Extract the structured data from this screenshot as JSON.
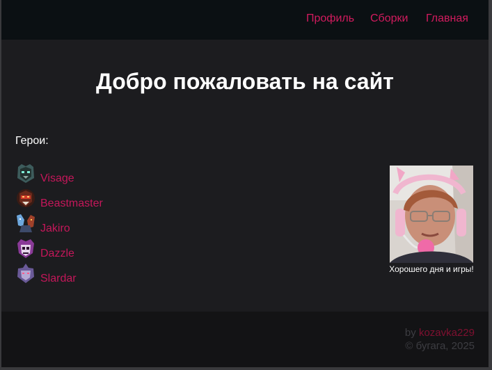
{
  "nav": {
    "links": [
      {
        "label": "Профиль"
      },
      {
        "label": "Сборки"
      },
      {
        "label": "Главная"
      }
    ]
  },
  "main": {
    "title": "Добро пожаловать на сайт",
    "heroes_label": "Герои:",
    "heroes": [
      {
        "name": "Visage",
        "icon": "visage-icon",
        "color": "#4a7a7a"
      },
      {
        "name": "Beastmaster",
        "icon": "beastmaster-icon",
        "color": "#b8382c"
      },
      {
        "name": "Jakiro",
        "icon": "jakiro-icon",
        "color": "#5a8fc8"
      },
      {
        "name": "Dazzle",
        "icon": "dazzle-icon",
        "color": "#9a4aa8"
      },
      {
        "name": "Slardar",
        "icon": "slardar-icon",
        "color": "#8a7ab8"
      }
    ],
    "promo_caption": "Хорошего дня и игры!"
  },
  "footer": {
    "by": "by",
    "author": "kozavka229",
    "copyright": "© бугага, 2025"
  },
  "colors": {
    "accent": "#d21b5e",
    "navbar_bg": "#0b1013",
    "page_bg": "#1c1c1f",
    "footer_bg": "#131315"
  }
}
